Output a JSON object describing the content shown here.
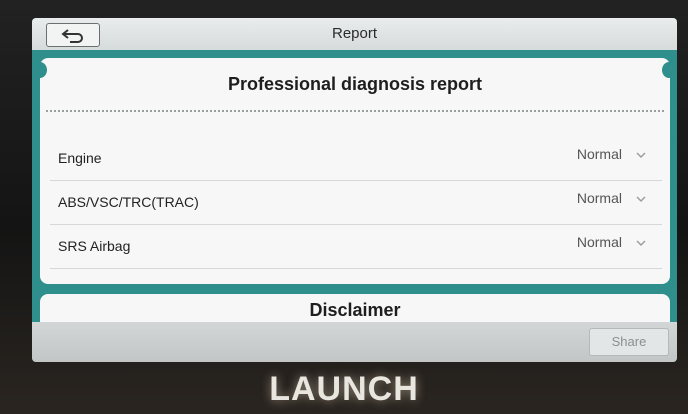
{
  "header": {
    "title": "Report",
    "back_icon": "back-arrow-icon"
  },
  "report": {
    "title": "Professional diagnosis report",
    "rows": [
      {
        "label": "Engine",
        "status": "Normal"
      },
      {
        "label": "ABS/VSC/TRC(TRAC)",
        "status": "Normal"
      },
      {
        "label": "SRS Airbag",
        "status": "Normal"
      }
    ]
  },
  "disclaimer": {
    "title": "Disclaimer"
  },
  "footer": {
    "share_label": "Share"
  },
  "device": {
    "brand": "LAUNCH"
  },
  "colors": {
    "accent": "#2f8f8c",
    "card": "#f6f7f6",
    "topbar": "#e2e6e6"
  }
}
